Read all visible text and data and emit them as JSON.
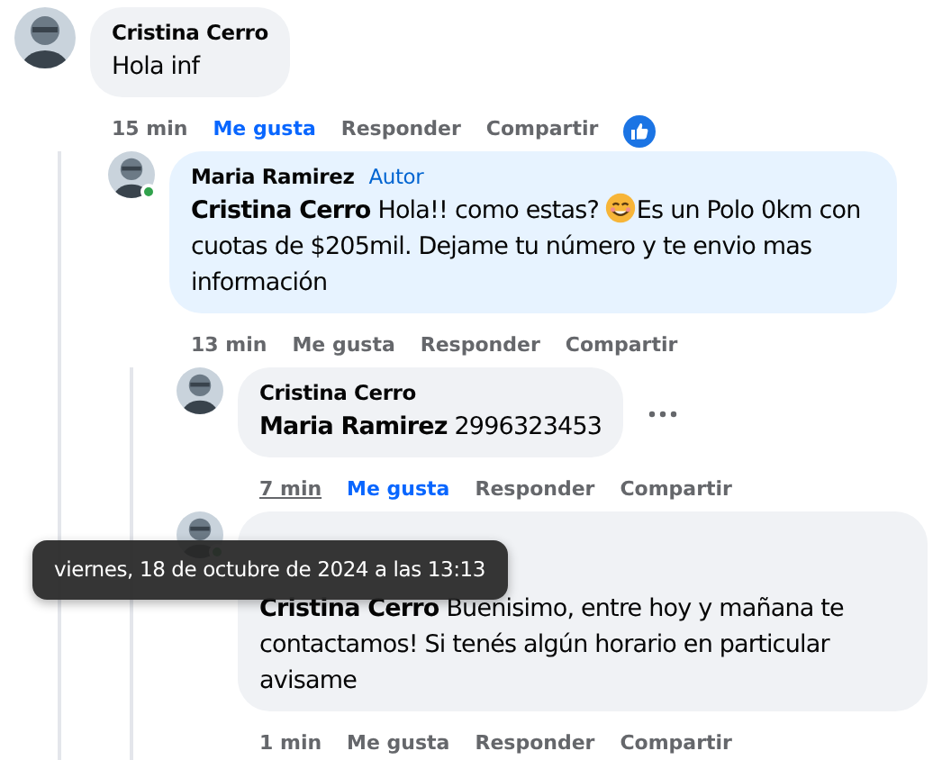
{
  "comments": [
    {
      "author": "Cristina Cerro",
      "online": false,
      "message": [
        {
          "kind": "text",
          "text": "Hola inf"
        }
      ],
      "time": "15 min",
      "time_hovered": false,
      "like": {
        "label": "Me gusta",
        "selected": true
      },
      "reply": "Responder",
      "share": "Compartir",
      "reaction_shown": true,
      "menu": false,
      "replies": [
        {
          "author": "Maria Ramirez",
          "badge": "Autor",
          "online": true,
          "highlighted": true,
          "message": [
            {
              "kind": "mention",
              "text": "Cristina Cerro"
            },
            {
              "kind": "text",
              "text": " Hola!! como estas? "
            },
            {
              "kind": "emoji"
            },
            {
              "kind": "text",
              "text": "Es un Polo 0km con cuotas de $205mil. Dejame tu número y te envio mas información"
            }
          ],
          "time": "13 min",
          "time_hovered": false,
          "like": {
            "label": "Me gusta",
            "selected": false
          },
          "reply": "Responder",
          "share": "Compartir",
          "menu": false,
          "replies": [
            {
              "author": "Cristina Cerro",
              "online": false,
              "message": [
                {
                  "kind": "mention",
                  "text": "Maria Ramirez"
                },
                {
                  "kind": "text",
                  "text": " 2996323453"
                }
              ],
              "time": "7 min",
              "time_hovered": true,
              "like": {
                "label": "Me gusta",
                "selected": true
              },
              "reply": "Responder",
              "share": "Compartir",
              "menu": true
            },
            {
              "online": true,
              "message": [
                {
                  "kind": "mention",
                  "text": "Cristina Cerro"
                },
                {
                  "kind": "text",
                  "text": " Buenisimo, entre hoy y mañana te contactamos! Si tenés algún horario en particular avisame"
                }
              ],
              "time": "1 min",
              "time_hovered": false,
              "like": {
                "label": "Me gusta",
                "selected": false
              },
              "reply": "Responder",
              "share": "Compartir",
              "menu": false
            }
          ]
        }
      ]
    }
  ],
  "tooltip": {
    "text": "viernes, 18 de octubre de 2024 a las 13:13"
  }
}
